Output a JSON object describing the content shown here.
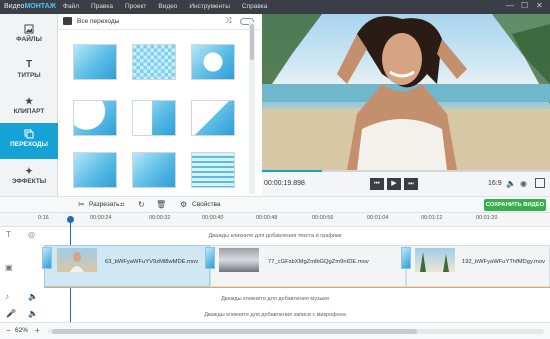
{
  "app": {
    "logo_prefix": "Видео",
    "logo_suffix": "МОНТАЖ",
    "menu": [
      "Файл",
      "Правка",
      "Проект",
      "Видео",
      "Инструменты",
      "Справка"
    ],
    "window_controls": [
      "—",
      "☐",
      "✕"
    ]
  },
  "nav": {
    "items": [
      {
        "label": "ФАЙЛЫ",
        "icon": "image-icon"
      },
      {
        "label": "ТИТРЫ",
        "icon": "title-t-icon"
      },
      {
        "label": "КЛИПАРТ",
        "icon": "star-icon"
      },
      {
        "label": "ПЕРЕХОДЫ",
        "icon": "transitions-icon",
        "active": true
      },
      {
        "label": "ЭФФЕКТЫ",
        "icon": "magic-wand-icon"
      }
    ]
  },
  "panel": {
    "category": "Все переходы",
    "thumbnails_count": 12
  },
  "preview": {
    "time": "00:00:19.898",
    "aspect": "16:9",
    "progress": 0.21
  },
  "toolbar": {
    "cut": "Разрезать",
    "properties": "Свойства",
    "save": "СОХРАНИТЬ ВИДЕО"
  },
  "ruler": {
    "ticks": [
      "0:16",
      "00:00:24",
      "00:00:32",
      "00:00:40",
      "00:00:48",
      "00:00:56",
      "00:01:04",
      "00:01:12",
      "00:01:20"
    ]
  },
  "timeline": {
    "text_hint": "Дважды кликните для добавления текста и графики",
    "music_hint": "Дважды кликните для добавления музыки",
    "mic_hint": "Дважды кликните для добавления записи с микрофона",
    "clips": [
      {
        "name": "63_bWFyaWFuYV9zMl8wMDE.mov"
      },
      {
        "name": "77_cGFsbXMgZmlbGQgZm9nIDE.mov"
      },
      {
        "name": "192_bWFyaWFuYThfMDgy.mov"
      }
    ],
    "zoom": "62%"
  }
}
